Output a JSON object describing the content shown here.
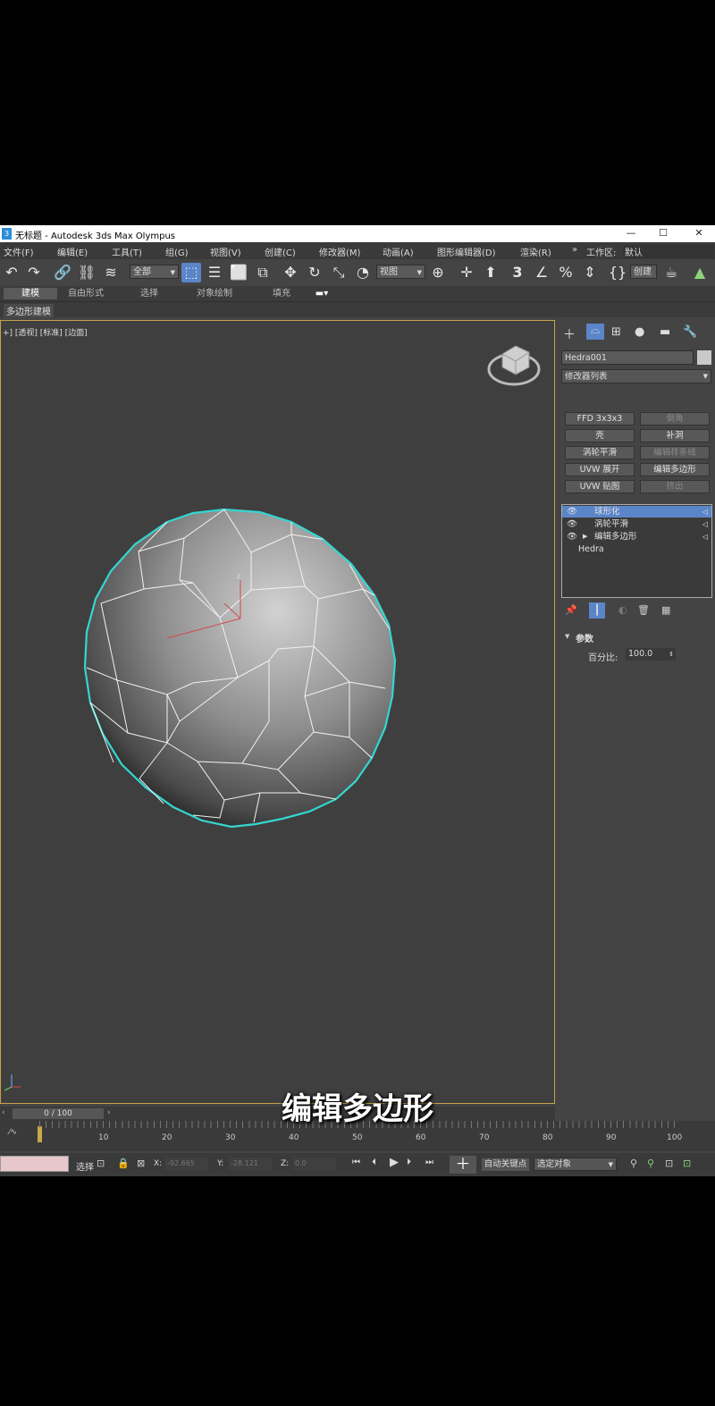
{
  "titlebar": {
    "icon": "3ds-max-icon",
    "title": "无标题 - Autodesk 3ds Max Olympus",
    "minimize": "—",
    "maximize": "☐",
    "close": "✕"
  },
  "menu": {
    "items": [
      "文件(F)",
      "编辑(E)",
      "工具(T)",
      "组(G)",
      "视图(V)",
      "创建(C)",
      "修改器(M)",
      "动画(A)",
      "图形编辑器(D)",
      "渲染(R)"
    ],
    "more": "»",
    "workspace_label": "工作区:",
    "workspace_value": "默认"
  },
  "toolbar": {
    "selection_filter": "全部",
    "ref_coord": "视图",
    "create_selection_set": "创建"
  },
  "ribbon": {
    "tabs": [
      "建模",
      "自由形式",
      "选择",
      "对象绘制",
      "填充"
    ],
    "sub_tab": "多边形建模"
  },
  "viewport": {
    "label": "+] [透视] [标准] [边面]",
    "colors": {
      "selection_outline": "#35d6d0",
      "wireframe": "#ffffff",
      "frame_border": "#c8a24a"
    }
  },
  "command_panel": {
    "object_name": "Hedra001",
    "modifier_list": "修改器列表",
    "modifier_buttons": [
      {
        "label": "FFD 3x3x3",
        "enabled": true
      },
      {
        "label": "倒角",
        "enabled": false
      },
      {
        "label": "壳",
        "enabled": true
      },
      {
        "label": "补洞",
        "enabled": true
      },
      {
        "label": "涡轮平滑",
        "enabled": true
      },
      {
        "label": "编辑样条线",
        "enabled": false
      },
      {
        "label": "UVW 展开",
        "enabled": true
      },
      {
        "label": "编辑多边形",
        "enabled": true
      },
      {
        "label": "UVW 贴图",
        "enabled": true
      },
      {
        "label": "挤出",
        "enabled": false
      }
    ],
    "stack": [
      {
        "label": "球形化",
        "selected": true
      },
      {
        "label": "涡轮平滑",
        "selected": false
      },
      {
        "label": "编辑多边形",
        "selected": false
      },
      {
        "label": "Hedra",
        "selected": false
      }
    ],
    "params_title": "参数",
    "percent_label": "百分比:",
    "percent_value": "100.0"
  },
  "timeline": {
    "frame_display": "0 / 100",
    "ticks": [
      "10",
      "20",
      "30",
      "40",
      "50",
      "60",
      "70",
      "80",
      "90",
      "100"
    ]
  },
  "statusbar": {
    "select_label": "选择",
    "x_label": "X:",
    "x_value": "-92.665",
    "y_label": "Y:",
    "y_value": "-28.121",
    "z_label": "Z:",
    "z_value": "0.0",
    "auto_key": "自动关键点",
    "selected_object": "选定对象"
  },
  "caption": "编辑多边形"
}
